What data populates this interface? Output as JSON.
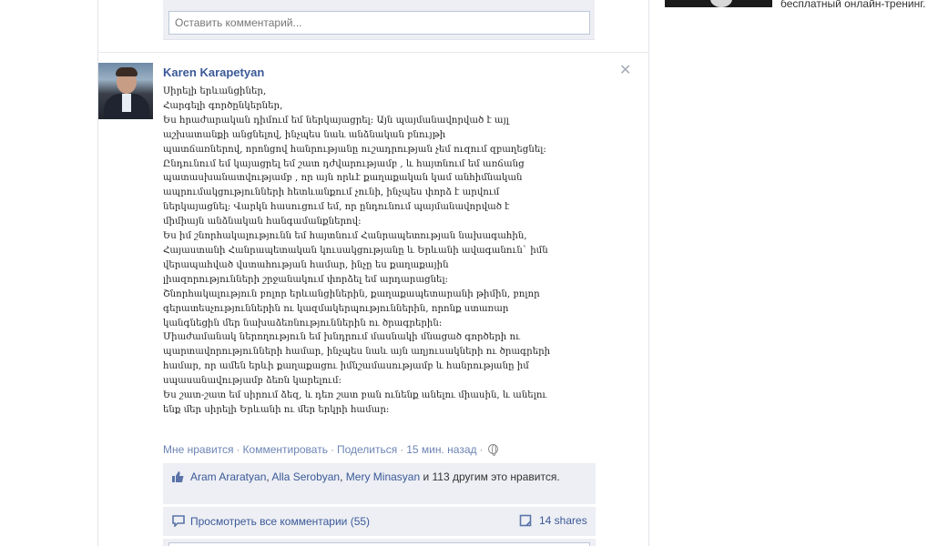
{
  "top_comment": {
    "placeholder": "Оставить комментарий..."
  },
  "post": {
    "author": "Karen Karapetyan",
    "lines": [
      "Սիրելի երևանցիներ,",
      "Հարգելի գործընկերներ,",
      "Ես հրաժարական դիմում եմ ներկայացրել: Այն պայմանավորված է այլ",
      "աշխատանքի անցնելով, ինչպես նաև անձնական բնույթի",
      "պատճառներով, որոնցով հանրությանը ուշադրության չեմ ուզում զբաղեցնել:",
      "Ընդունում եմ կայացրել եմ շատ դժվարությամբ , և հայտնում եմ առճանց",
      "պատասխանատվությամբ , որ այն որևէ քաղաքական կամ անհիմնական",
      "ապրումակցությունների հետևանքում չունի, ինչպես փորձ է արվում",
      "ներկայացնել: Վարկն հասուցում եմ, որ ընդունում պայմանավորված է",
      "միմիայն անձնական հանգամանքներով:",
      "Ես իմ շնորհակալությունն եմ հայտնում Հանրապետության նախագահին,",
      "Հայաստանի Հանրապետական կուսակցությանը և Երևանի ավագանուն` իմն",
      "վերապահված վստահության համար, ինչը ես քաղաքային",
      "լիազորությունների շրջանակում փորձել եմ արդարացնել:",
      "Շնորհակալություն բոլոր երևանցիներին, քաղաքապետարանի թիմին, բոլոր",
      "գերատեսչություններին ու կազմակերպություններին, որոնք ստառար",
      "կանգնեցին մեր նախաձեռնություններին ու ծրագրերին:",
      "Միաժամանակ ներողություն եմ խնդրում մասնակի մնացած գործերի ու",
      "պարտավորությունների համար, ինչպես նաև այն աղյուսակների ու ծրագրերի",
      "համար, որ ամեն երևի քաղաքացու իմնշամասությամբ և հանրությանը իմ",
      "սպասանավությամբ ձեռն կարելում:",
      "Ես շատ-շատ եմ սիրում ձեզ, և դեռ շատ բան ունենք անելու միասին, և անելու",
      "ենք մեր սիրելի Երևանի ու մեր երկրի համար:"
    ]
  },
  "actions": {
    "like": "Мне нравится",
    "comment": "Комментировать",
    "share": "Поделиться",
    "time": "15 мин. назад"
  },
  "likes": {
    "names": [
      "Aram Araratyan",
      "Alla Serobyan",
      "Mery Minasyan"
    ],
    "rest": "и 113 другим это нравится."
  },
  "comments": {
    "view_all": "Просмотреть все комментарии (55)"
  },
  "shares": {
    "label": "14 shares"
  },
  "ad": {
    "text": "бесплатный онлайн-тренинг."
  },
  "icons": [
    "close-icon",
    "globe-icon",
    "thumbs-up-icon",
    "comments-icon",
    "shares-icon"
  ],
  "colors": {
    "link": "#3b5998",
    "panel": "#edeff4",
    "muted": "#7f7f7f"
  }
}
